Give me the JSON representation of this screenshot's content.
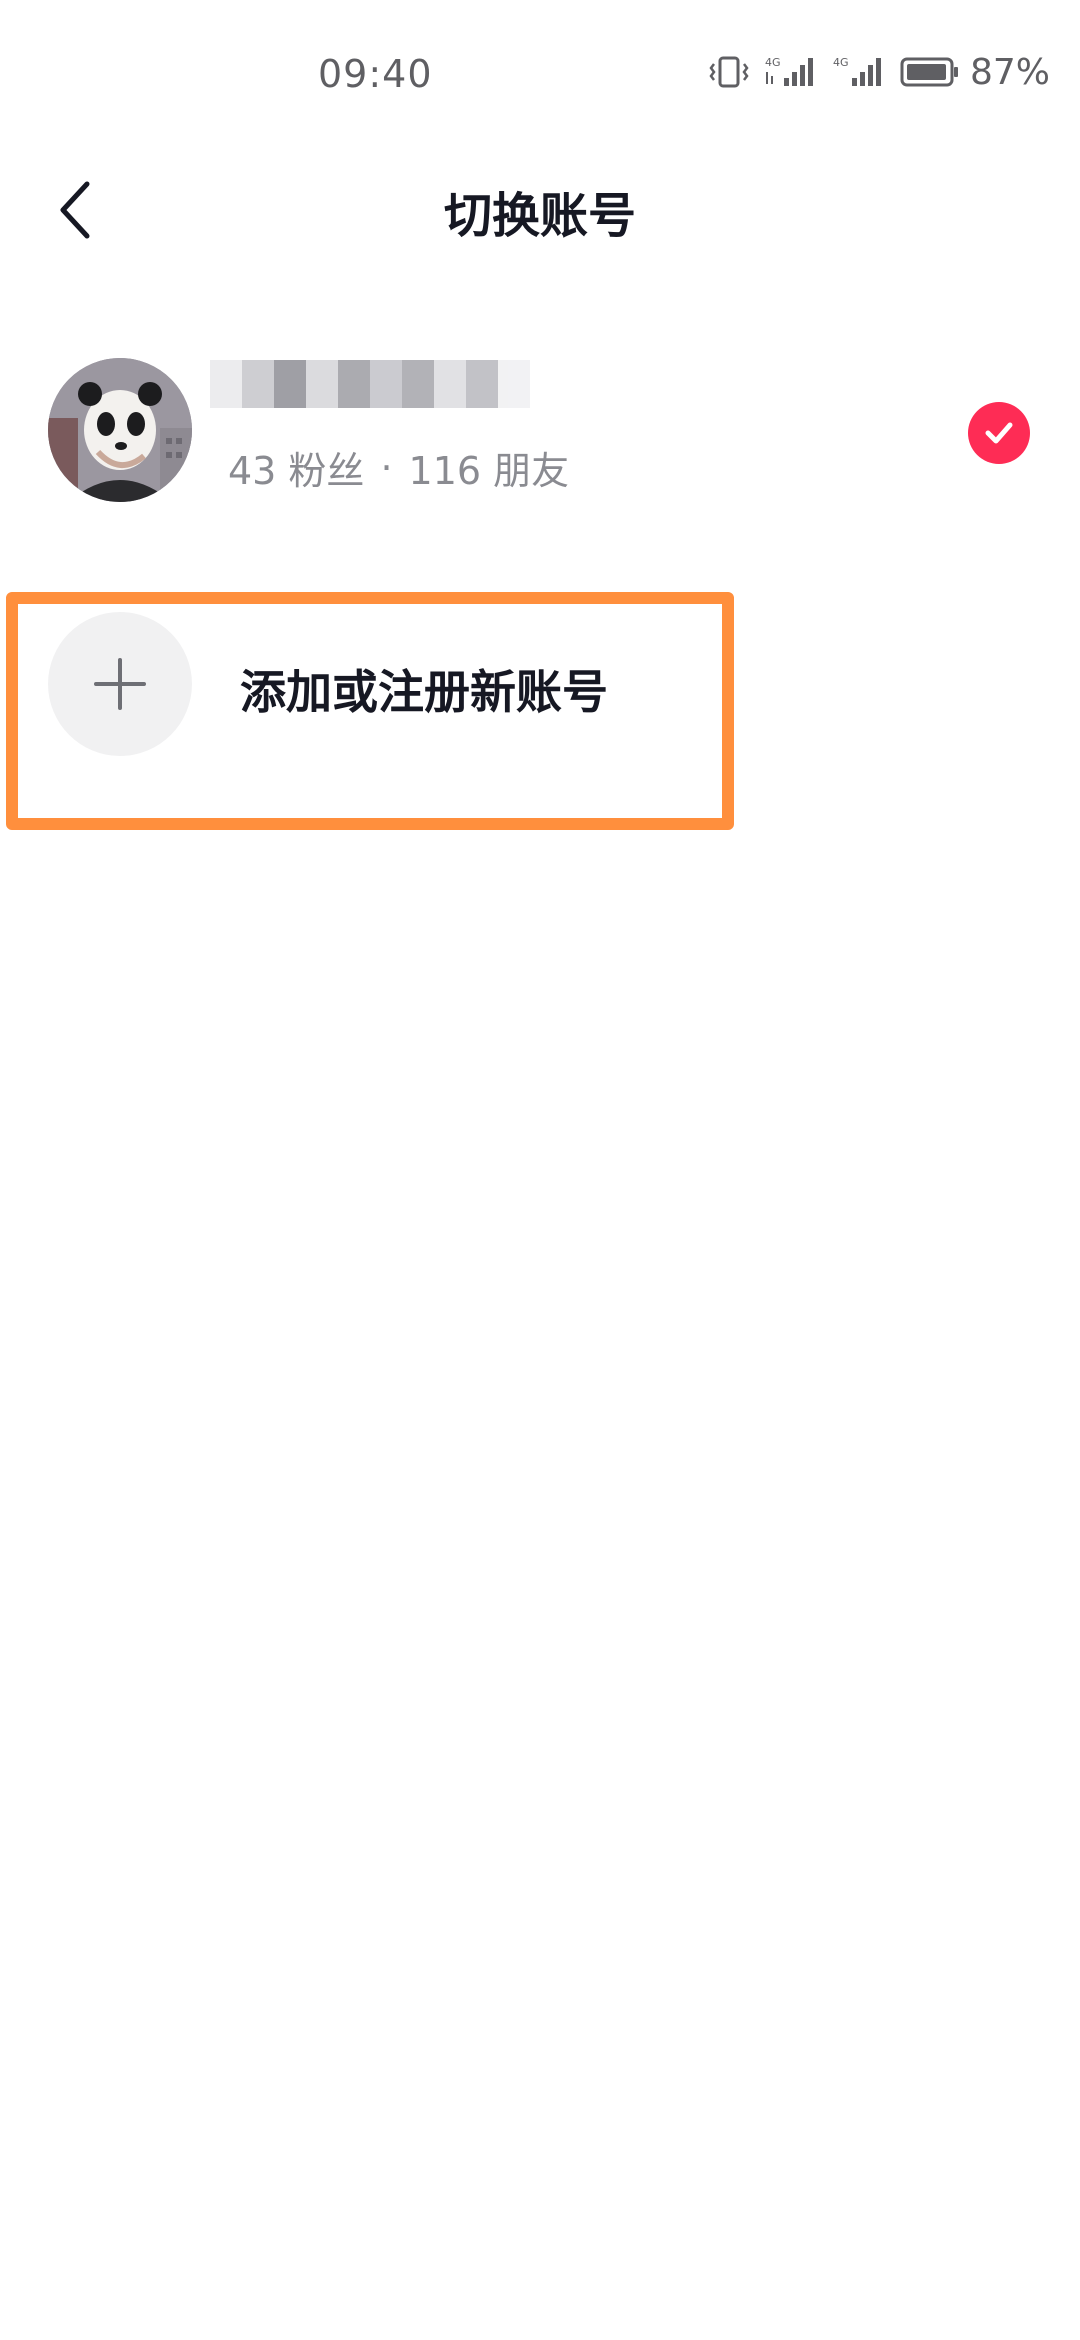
{
  "status_bar": {
    "time": "09:40",
    "battery_percent": "87%",
    "network_label_1": "4G",
    "network_label_2": "4G"
  },
  "header": {
    "title": "切换账号"
  },
  "account": {
    "followers": "43 粉丝",
    "separator": "·",
    "friends": "116 朋友",
    "selected": true
  },
  "add_account": {
    "label": "添加或注册新账号"
  },
  "colors": {
    "accent": "#fe2c55",
    "highlight": "#ff8f3d"
  },
  "icons": {
    "back": "back-arrow-icon",
    "check": "check-icon",
    "plus": "plus-icon"
  }
}
